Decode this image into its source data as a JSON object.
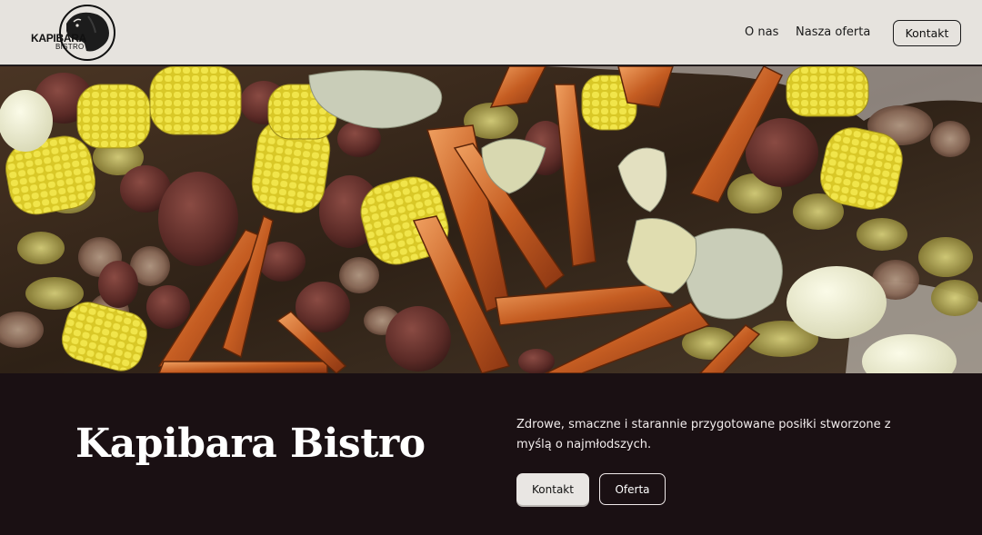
{
  "header": {
    "logo_text": "KAPIBARA",
    "logo_sub": "BISTRO",
    "nav": [
      {
        "label": "O nas"
      },
      {
        "label": "Nasza oferta"
      }
    ],
    "cta_label": "Kontakt"
  },
  "hero": {
    "image_subject": "seafood-boil"
  },
  "main": {
    "title": "Kapibara Bistro",
    "tagline": "Zdrowe, smaczne i starannie przygotowane posiłki stworzone z myślą o najmłodszych.",
    "primary_button": "Kontakt",
    "secondary_button": "Oferta"
  },
  "colors": {
    "header_bg": "#e6e3de",
    "footer_bg": "#1a1013",
    "accent_light": "#e9e6e3"
  }
}
